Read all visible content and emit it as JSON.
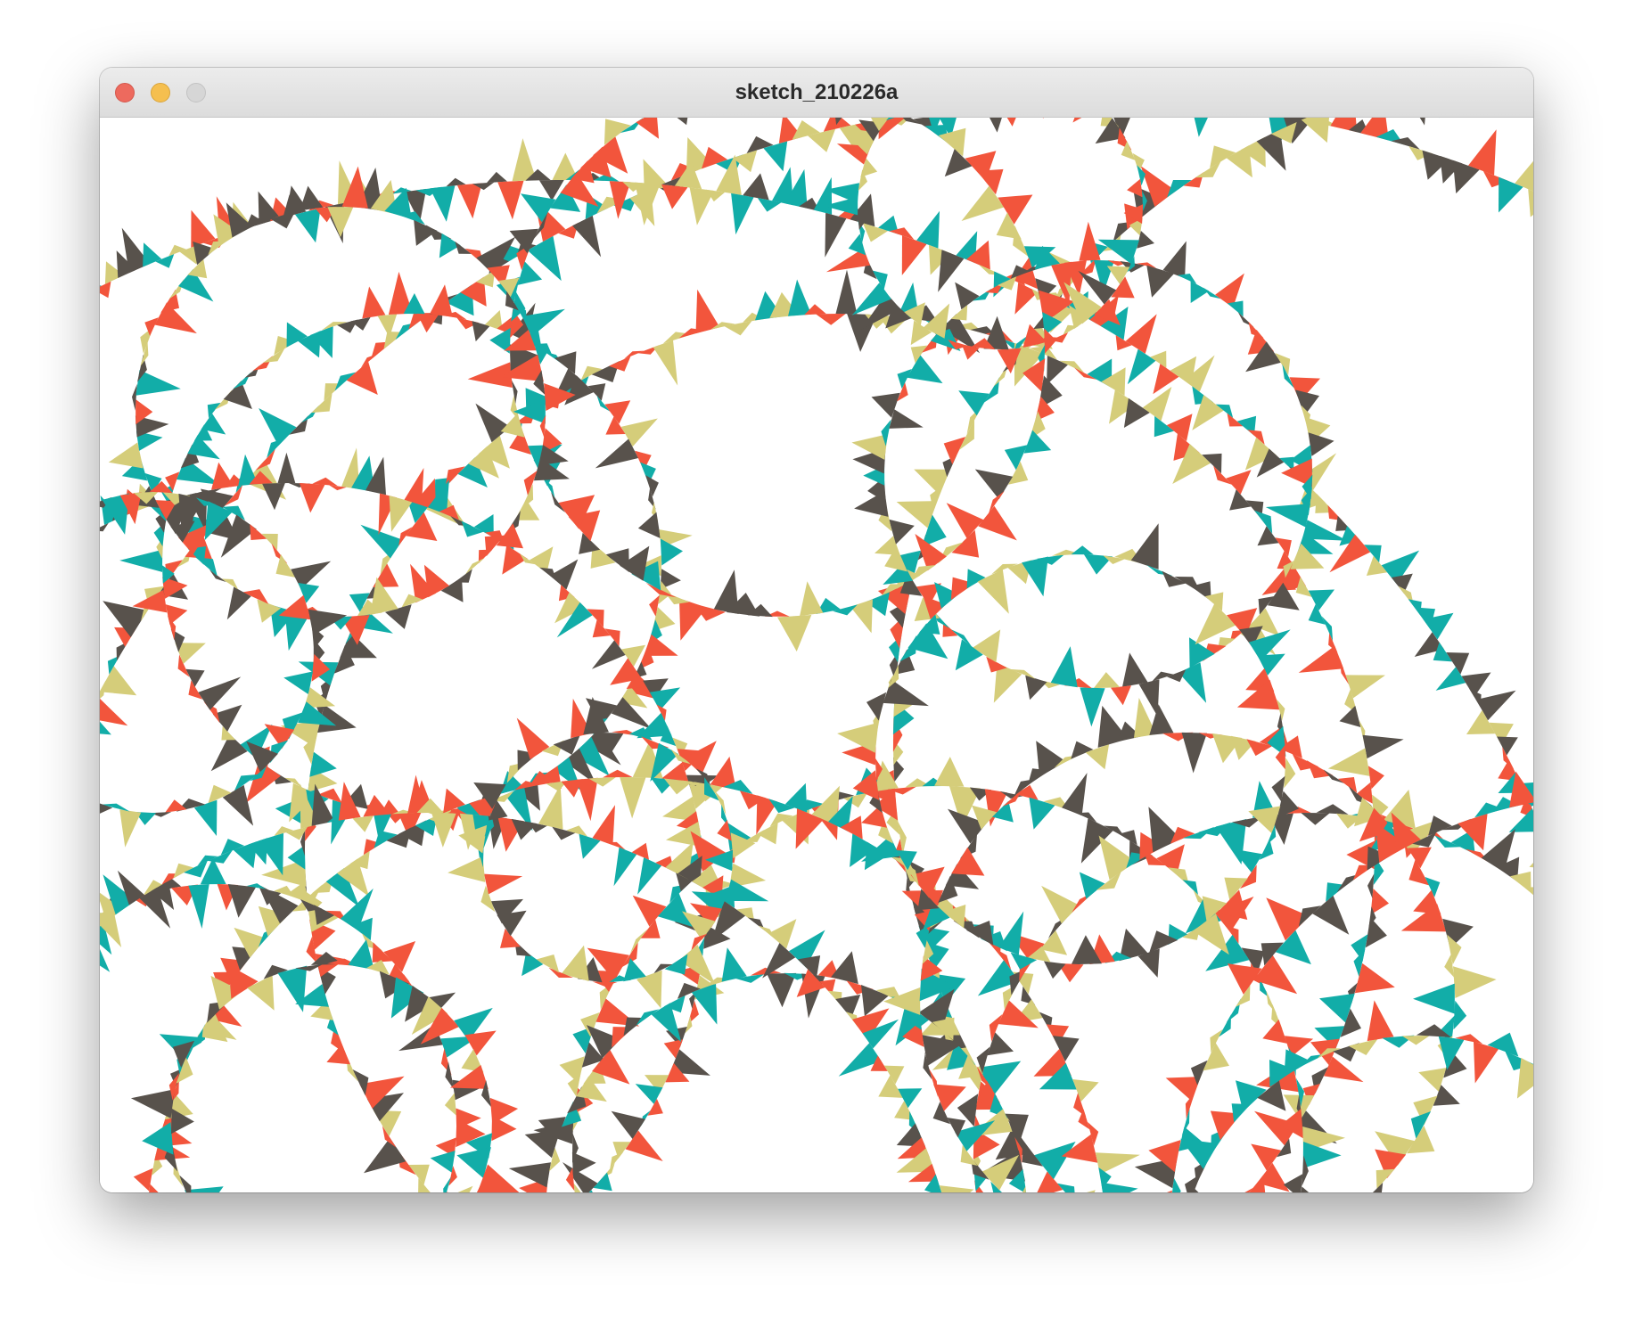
{
  "window": {
    "title": "sketch_210226a"
  },
  "traffic_lights": {
    "close_color": "#ed6a5e",
    "minimize_color": "#f5bf4f",
    "zoom_color": "#d6d6d6"
  },
  "sketch": {
    "background": "#ffffff",
    "palette": [
      "#12ada8",
      "#f2553c",
      "#d5cd7a",
      "#58524c"
    ]
  }
}
